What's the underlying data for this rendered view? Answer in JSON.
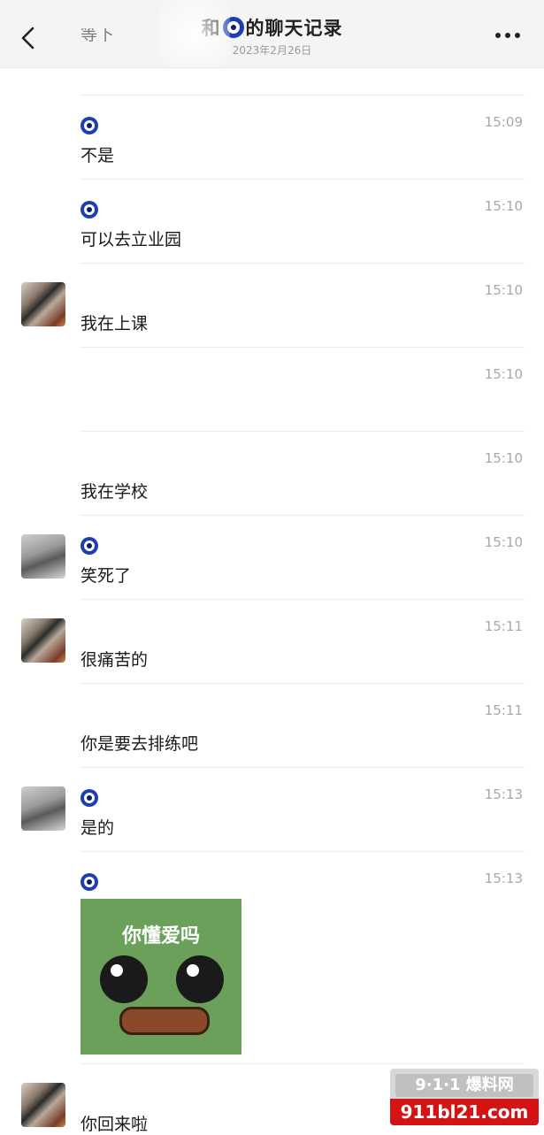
{
  "header": {
    "title_prefix": "和",
    "title_suffix": "的聊天记录",
    "subtitle": "2023年2月26日",
    "back_icon": "chevron-left-icon",
    "more_icon": "more-icon"
  },
  "messages": [
    {
      "id": "m0",
      "text": "等下"
    },
    {
      "id": "m1",
      "sender_icon": "nazar-eye-icon",
      "time": "15:09",
      "text": "不是"
    },
    {
      "id": "m2",
      "sender_icon": "nazar-eye-icon",
      "time": "15:10",
      "text": "可以去立业园"
    },
    {
      "id": "m3",
      "avatar": "avatar",
      "time": "15:10",
      "text": "我在上课"
    },
    {
      "id": "m4",
      "time": "15:10",
      "text": ""
    },
    {
      "id": "m5",
      "time": "15:10",
      "text": "我在学校"
    },
    {
      "id": "m6",
      "avatar": "avatar",
      "sender_icon": "nazar-eye-icon",
      "time": "15:10",
      "text": "笑死了"
    },
    {
      "id": "m7",
      "avatar": "avatar",
      "time": "15:11",
      "text": "很痛苦的"
    },
    {
      "id": "m8",
      "time": "15:11",
      "text": "你是要去排练吧"
    },
    {
      "id": "m9",
      "avatar": "avatar",
      "sender_icon": "nazar-eye-icon",
      "time": "15:13",
      "text": "是的"
    },
    {
      "id": "m10",
      "sender_icon": "nazar-eye-icon",
      "time": "15:13",
      "sticker_caption": "你懂爱吗"
    },
    {
      "id": "m11",
      "avatar": "avatar",
      "text": "你回来啦"
    }
  ],
  "watermark": {
    "top": "9·1·1 爆料网",
    "bottom": "911bl21.com"
  }
}
